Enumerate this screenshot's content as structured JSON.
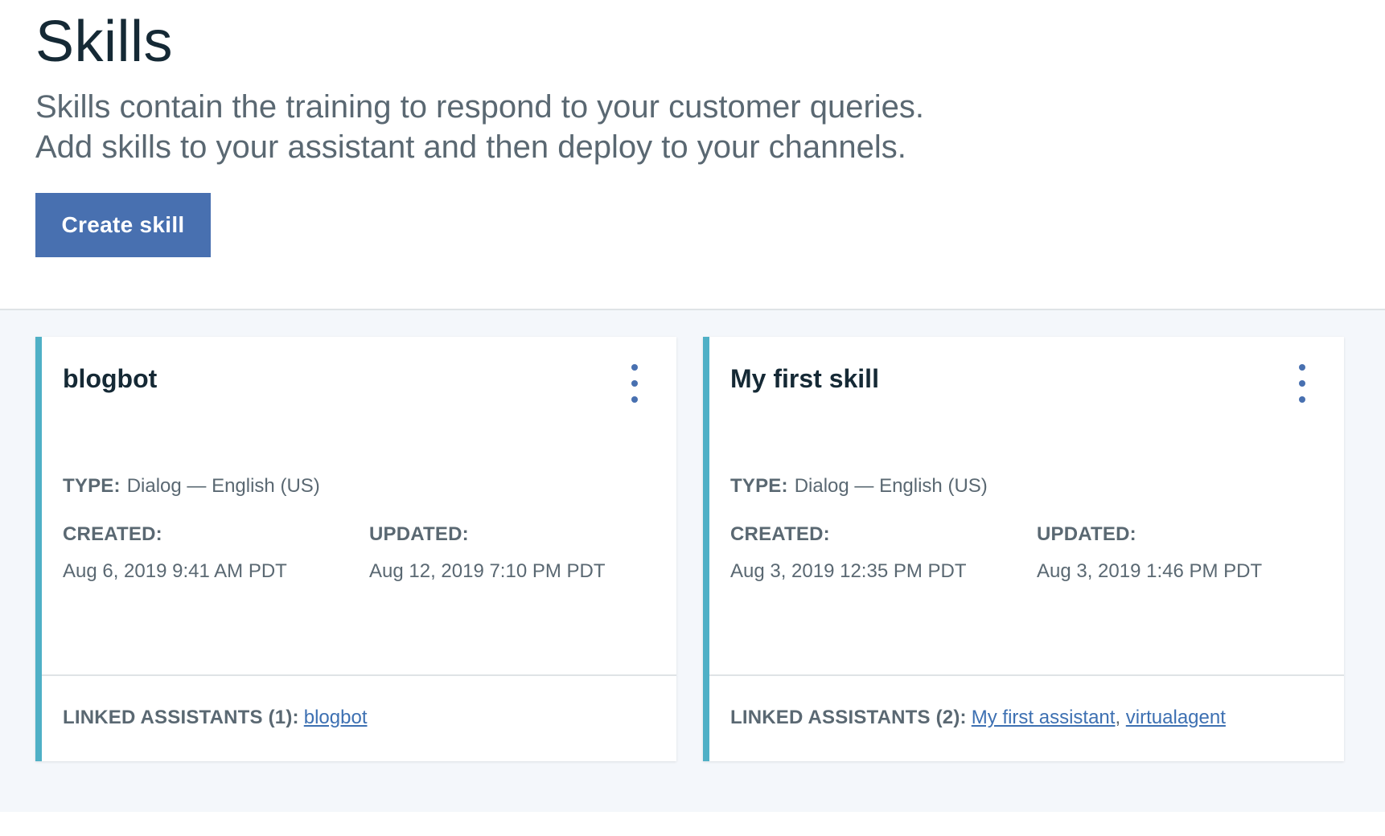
{
  "header": {
    "title": "Skills",
    "description_line1": "Skills contain the training to respond to your customer queries.",
    "description_line2": "Add skills to your assistant and then deploy to your channels.",
    "create_button_label": "Create skill"
  },
  "colors": {
    "primary": "#4870b0",
    "accent_border": "#4fb0c6",
    "link": "#3d70b2",
    "cards_background": "#f4f7fb"
  },
  "labels": {
    "type": "TYPE:",
    "created": "CREATED:",
    "updated": "UPDATED:"
  },
  "cards": [
    {
      "title": "blogbot",
      "type": "Dialog — English (US)",
      "created": "Aug 6, 2019 9:41 AM PDT",
      "updated": "Aug 12, 2019 7:10 PM PDT",
      "linked_label": "LINKED ASSISTANTS (1):",
      "linked_assistants": [
        "blogbot"
      ],
      "menu_icon": "overflow-menu-vertical-icon"
    },
    {
      "title": "My first skill",
      "type": "Dialog — English (US)",
      "created": "Aug 3, 2019 12:35 PM PDT",
      "updated": "Aug 3, 2019 1:46 PM PDT",
      "linked_label": "LINKED ASSISTANTS (2):",
      "linked_assistants": [
        "My first assistant",
        "virtualagent"
      ],
      "separator": ",",
      "menu_icon": "overflow-menu-vertical-icon"
    }
  ]
}
